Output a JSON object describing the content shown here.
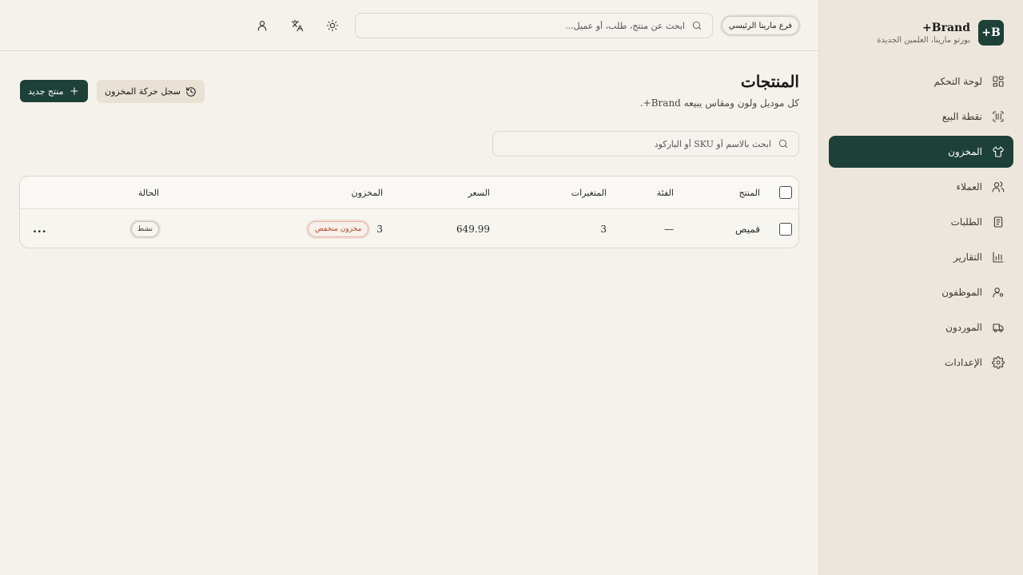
{
  "brand": {
    "logo": "B+",
    "name": "Brand+",
    "subtitle": "بورتو مارينا، العلمين الجديدة"
  },
  "sidebar": {
    "items": [
      {
        "label": "لوحة التحكم",
        "icon": "dashboard-icon",
        "active": false
      },
      {
        "label": "نقطة البيع",
        "icon": "scan-barcode-icon",
        "active": false
      },
      {
        "label": "المخزون",
        "icon": "shirt-icon",
        "active": true
      },
      {
        "label": "العملاء",
        "icon": "users-icon",
        "active": false
      },
      {
        "label": "الطلبات",
        "icon": "document-icon",
        "active": false
      },
      {
        "label": "التقارير",
        "icon": "bar-chart-icon",
        "active": false
      },
      {
        "label": "الموظفون",
        "icon": "user-cog-icon",
        "active": false
      },
      {
        "label": "الموردون",
        "icon": "truck-icon",
        "active": false
      },
      {
        "label": "الإعدادات",
        "icon": "gear-icon",
        "active": false
      }
    ]
  },
  "header": {
    "branch": "فرع مارينا الرئيسي",
    "search_placeholder": "ابحث عن منتج، طلب، أو عميل...",
    "icons": [
      "theme-sun-icon",
      "translate-icon",
      "user-icon"
    ]
  },
  "page": {
    "title": "المنتجات",
    "subtitle": "كل موديل ولون ومقاس يبيعه Brand+.",
    "new_button": "منتج جديد",
    "log_button": "سجل حركة المخزون",
    "search_placeholder": "ابحث بالاسم أو SKU أو الباركود"
  },
  "table": {
    "headers": {
      "product": "المنتج",
      "category": "الفئة",
      "variants": "المتغيرات",
      "price": "السعر",
      "stock": "المخزون",
      "status": "الحالة"
    },
    "rows": [
      {
        "product": "قميص",
        "category": "—",
        "variants": "3",
        "price": "649.99",
        "stock": "3",
        "stock_badge": "مخزون منخفض",
        "status": "نشط",
        "actions": "..."
      }
    ]
  },
  "colors": {
    "accent": "#1d4038",
    "background": "#f5f2ec",
    "sidebar": "#ede6dc",
    "low_stock": "#b0452a"
  }
}
